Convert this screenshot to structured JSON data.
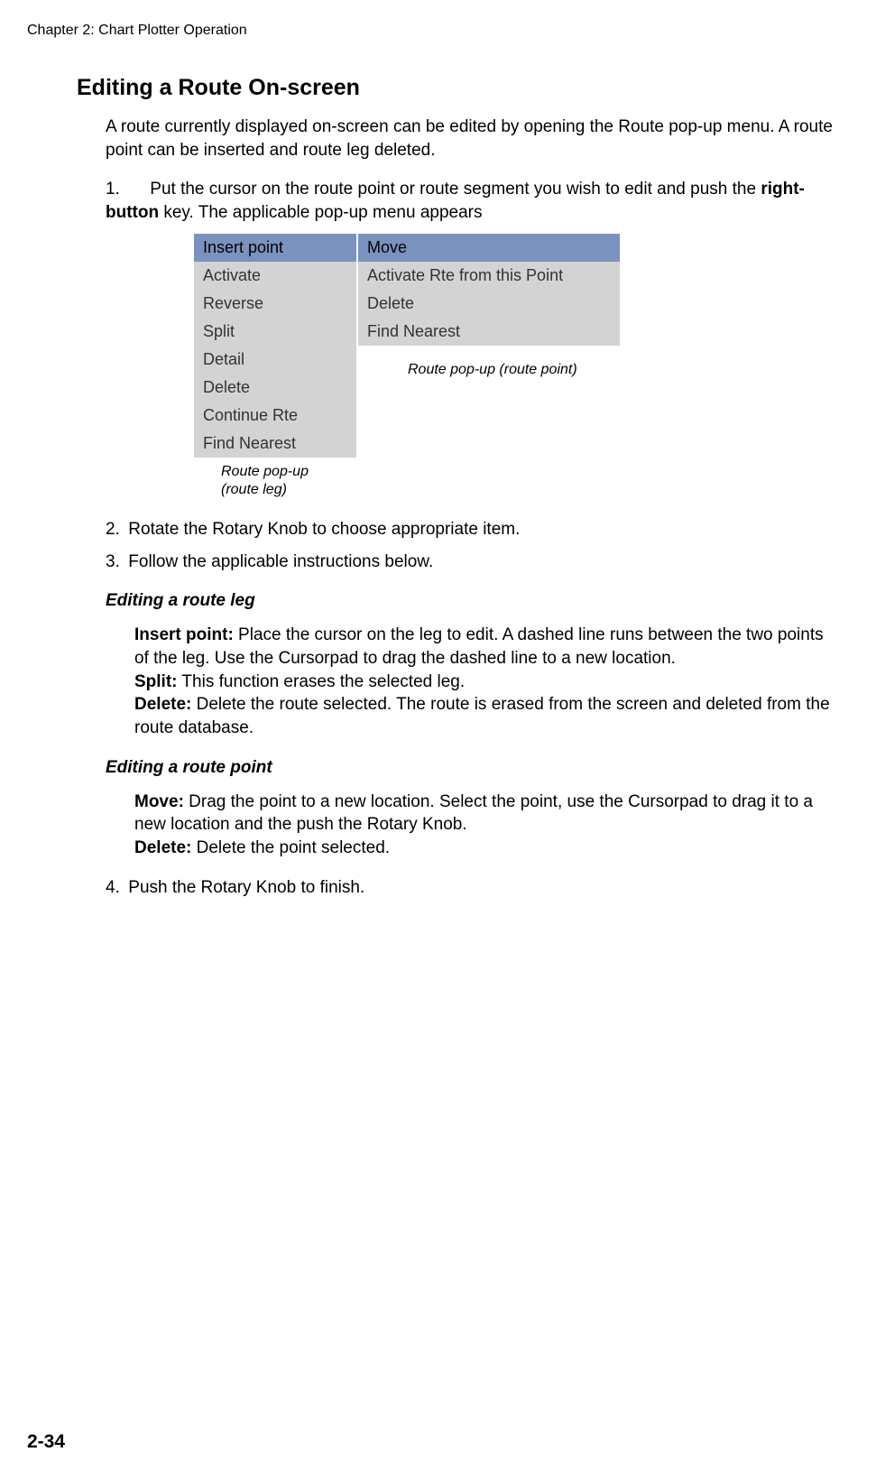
{
  "header": {
    "chapter": "Chapter 2: Chart Plotter Operation"
  },
  "section": {
    "title": "Editing a Route On-screen",
    "intro": "A route currently displayed on-screen can be edited by opening the Route pop-up menu. A route point can be inserted and route leg deleted."
  },
  "steps": {
    "s1_num": "1.",
    "s1_text_before": "Put the cursor on the route point or route segment you wish to edit and push the ",
    "s1_bold": "right-button",
    "s1_text_after": " key. The applicable pop-up menu appears",
    "s2_num": "2.",
    "s2_text": "Rotate the Rotary Knob to choose appropriate item.",
    "s3_num": "3.",
    "s3_text": "Follow the applicable instructions below.",
    "s4_num": "4.",
    "s4_text": "Push the Rotary Knob to finish."
  },
  "menu_leg": {
    "items": {
      "i0": "Insert point",
      "i1": "Activate",
      "i2": "Reverse",
      "i3": "Split",
      "i4": "Detail",
      "i5": "Delete",
      "i6": "Continue Rte",
      "i7": "Find Nearest"
    },
    "caption_line1": "Route pop-up",
    "caption_line2": "(route leg)"
  },
  "menu_point": {
    "items": {
      "i0": "Move",
      "i1": "Activate Rte from this Point",
      "i2": "Delete",
      "i3": "Find Nearest"
    },
    "caption": "Route pop-up (route point)"
  },
  "sub_leg": {
    "title": "Editing a route leg",
    "insert_label": "Insert point:",
    "insert_text": " Place the cursor on the leg to edit. A dashed line runs between the two points of the leg. Use the Cursorpad to drag the dashed line to a new location.",
    "split_label": "Split:",
    "split_text": " This function erases the selected leg.",
    "delete_label": "Delete:",
    "delete_text": " Delete the route selected. The route is erased from the screen and deleted from the route database."
  },
  "sub_point": {
    "title": "Editing a route point",
    "move_label": "Move:",
    "move_text": " Drag the point to a new location. Select the point, use the Cursorpad to drag it to a new location and the push the Rotary Knob.",
    "delete_label": "Delete:",
    "delete_text": " Delete the point selected."
  },
  "page_number": "2-34"
}
